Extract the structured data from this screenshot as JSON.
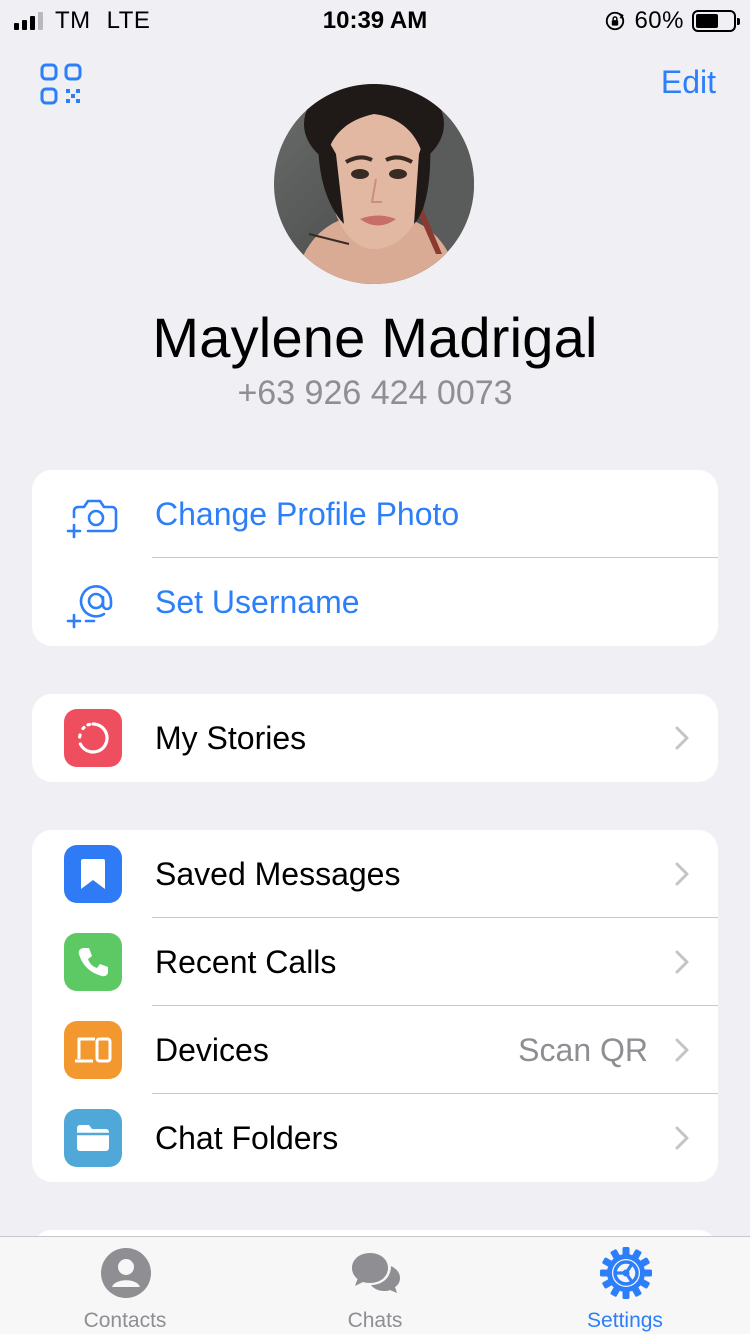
{
  "status_bar": {
    "carrier": "TM",
    "network": "LTE",
    "time": "10:39 AM",
    "battery": "60%",
    "battery_level": 0.6,
    "signal_bars": 3,
    "signal_bars_total": 4
  },
  "header": {
    "edit_label": "Edit",
    "qr_icon": "qr-code-icon"
  },
  "profile": {
    "name": "Maylene Madrigal",
    "phone": "+63 926 424 0073"
  },
  "profile_actions": [
    {
      "label": "Change Profile Photo",
      "icon": "camera-add-icon"
    },
    {
      "label": "Set Username",
      "icon": "at-add-icon"
    }
  ],
  "stories_group": [
    {
      "label": "My Stories",
      "icon": "stories-icon",
      "color": "#ef4e5e"
    }
  ],
  "menu_group": [
    {
      "label": "Saved Messages",
      "icon": "bookmark-icon",
      "color": "#2f7bf5",
      "value": ""
    },
    {
      "label": "Recent Calls",
      "icon": "phone-icon",
      "color": "#5cc964",
      "value": ""
    },
    {
      "label": "Devices",
      "icon": "devices-icon",
      "color": "#f2982f",
      "value": "Scan QR"
    },
    {
      "label": "Chat Folders",
      "icon": "folder-icon",
      "color": "#4fa8d8",
      "value": ""
    }
  ],
  "tabs": [
    {
      "label": "Contacts",
      "icon": "contacts-icon",
      "active": false
    },
    {
      "label": "Chats",
      "icon": "chats-icon",
      "active": false
    },
    {
      "label": "Settings",
      "icon": "settings-gear-icon",
      "active": true
    }
  ],
  "colors": {
    "accent": "#2d7ff9",
    "secondary_text": "#8e8e93",
    "background": "#efeff4"
  }
}
